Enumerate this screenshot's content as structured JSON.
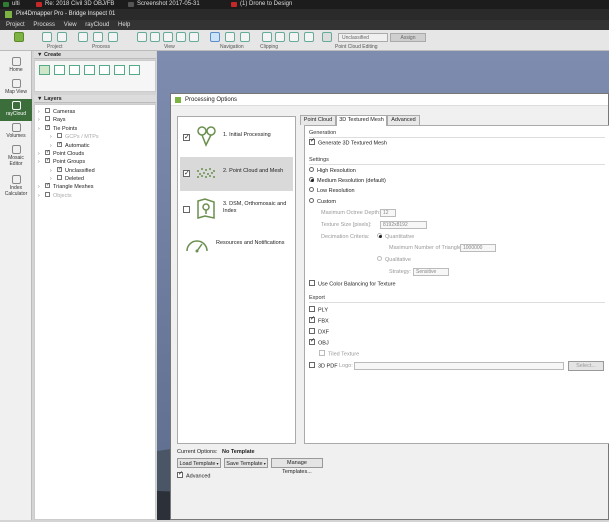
{
  "taskbar": {
    "tabs": [
      {
        "label": "ulti",
        "color": "#2e7d32"
      },
      {
        "label": "Re: 2018 Civil 3D OBJ/FB",
        "color": "#c62828"
      },
      {
        "label": "Screenshot 2017-05-31",
        "color": "#555555"
      },
      {
        "label": "(1) Drone to Design",
        "color": "#c62828"
      }
    ]
  },
  "app": {
    "title": "Pix4Dmapper Pro - Bridge Inspect 01",
    "menu": [
      "Project",
      "Process",
      "View",
      "rayCloud",
      "Help"
    ]
  },
  "toolbar": {
    "groups": [
      "Project",
      "Process",
      "View",
      "Navigation",
      "Clipping",
      "Point Cloud Editing"
    ],
    "classification_select": "Unclassified",
    "assign_button": "Assign"
  },
  "rail": {
    "items": [
      "Home",
      "Map View",
      "rayCloud",
      "Volumes",
      "Mosaic Editor",
      "Index Calculator"
    ],
    "active": "rayCloud"
  },
  "create_panel": {
    "title": "Create"
  },
  "layers_panel": {
    "title": "Layers",
    "rows": [
      {
        "label": "Cameras",
        "checked": false,
        "indent": 0,
        "dim": false
      },
      {
        "label": "Rays",
        "checked": false,
        "indent": 0,
        "dim": false
      },
      {
        "label": "Tie Points",
        "checked": true,
        "indent": 0,
        "dim": false
      },
      {
        "label": "GCPs / MTPs",
        "checked": false,
        "indent": 1,
        "dim": true
      },
      {
        "label": "Automatic",
        "checked": true,
        "indent": 1,
        "dim": false
      },
      {
        "label": "Point Clouds",
        "checked": true,
        "indent": 0,
        "dim": false
      },
      {
        "label": "Point Groups",
        "checked": true,
        "indent": 0,
        "dim": false
      },
      {
        "label": "Unclassified",
        "checked": true,
        "indent": 1,
        "dim": false
      },
      {
        "label": "Deleted",
        "checked": false,
        "indent": 1,
        "dim": false
      },
      {
        "label": "Triangle Meshes",
        "checked": true,
        "indent": 0,
        "dim": false
      },
      {
        "label": "Objects",
        "checked": false,
        "indent": 0,
        "dim": true
      }
    ]
  },
  "dialog": {
    "title": "Processing Options",
    "steps": [
      {
        "label": "1. Initial Processing",
        "checked": true,
        "selected": false
      },
      {
        "label": "2. Point Cloud and Mesh",
        "checked": true,
        "selected": true
      },
      {
        "label": "3. DSM, Orthomosaic and Index",
        "checked": false,
        "selected": false
      },
      {
        "label": "Resources and Notifications",
        "checked": false,
        "selected": false
      }
    ],
    "tabs": [
      "Point Cloud",
      "3D Textured Mesh",
      "Advanced"
    ],
    "active_tab": "3D Textured Mesh",
    "generation": {
      "heading": "Generation",
      "generate_label": "Generate 3D Textured Mesh",
      "generate_checked": true
    },
    "settings": {
      "heading": "Settings",
      "options": [
        "High Resolution",
        "Medium Resolution (default)",
        "Low Resolution",
        "Custom"
      ],
      "selected": "Medium Resolution (default)",
      "max_octree_label": "Maximum Octree Depth:",
      "max_octree_value": "12",
      "texture_size_label": "Texture Size [pixels]:",
      "texture_size_value": "8192x8192",
      "decimation_label": "Decimation Criteria:",
      "quantitative_label": "Quantitative",
      "max_triangles_label": "Maximum Number of Triangles:",
      "max_triangles_value": "1000000",
      "qualitative_label": "Qualitative",
      "strategy_label": "Strategy:",
      "strategy_value": "Sensitive",
      "color_balancing_label": "Use Color Balancing for Texture",
      "color_balancing_checked": false
    },
    "export": {
      "heading": "Export",
      "formats": [
        {
          "label": "PLY",
          "checked": false
        },
        {
          "label": "FBX",
          "checked": true
        },
        {
          "label": "DXF",
          "checked": false
        },
        {
          "label": "OBJ",
          "checked": true
        }
      ],
      "tiled_texture_label": "Tiled Texture",
      "pdf_label": "3D PDF",
      "logo_label": "Logo:",
      "select_button": "Select..."
    },
    "footer": {
      "current_options_label": "Current Options:",
      "current_options_value": "No Template",
      "load_template": "Load Template",
      "save_template": "Save Template",
      "manage_templates": "Manage Templates...",
      "advanced_label": "Advanced",
      "advanced_checked": true
    }
  }
}
